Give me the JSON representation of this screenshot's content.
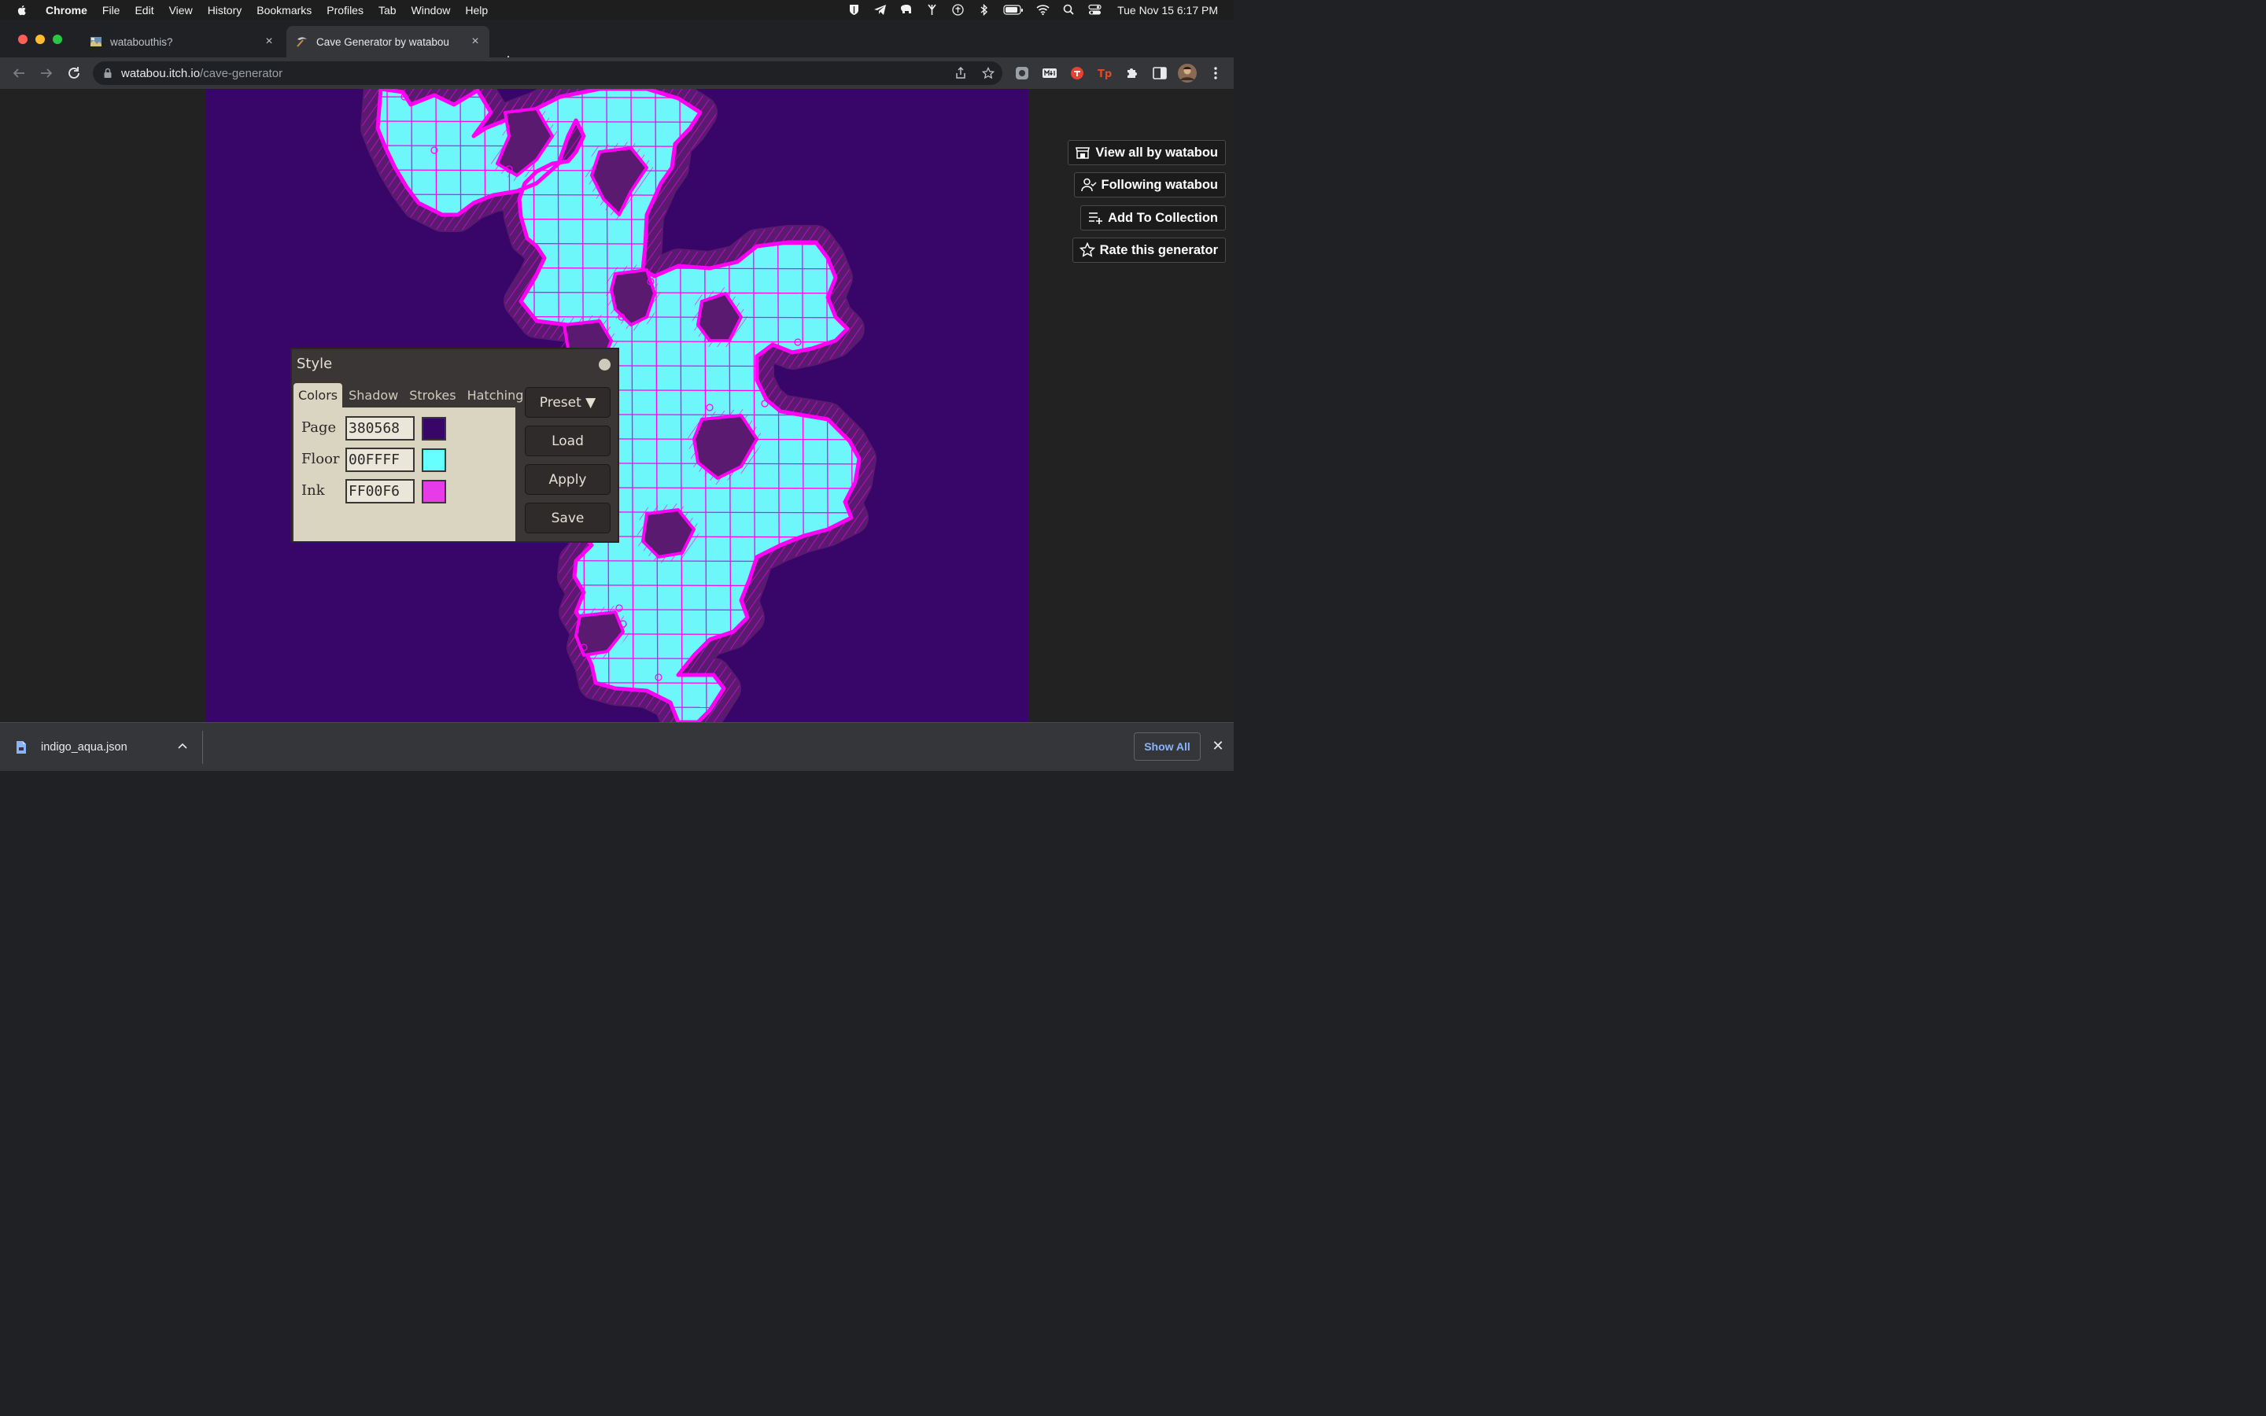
{
  "menubar": {
    "app": "Chrome",
    "menus": [
      "File",
      "Edit",
      "View",
      "History",
      "Bookmarks",
      "Profiles",
      "Tab",
      "Window",
      "Help"
    ],
    "clock": "Tue Nov 15  6:17 PM"
  },
  "tabs": [
    {
      "title": "watabouthis?",
      "active": false
    },
    {
      "title": "Cave Generator by watabou",
      "active": true
    }
  ],
  "address": {
    "host": "watabou.itch.io",
    "path": "/cave-generator"
  },
  "side_buttons": [
    {
      "label": "View all by watabou",
      "icon": "store-icon"
    },
    {
      "label": "Following watabou",
      "icon": "user-check-icon"
    },
    {
      "label": "Add To Collection",
      "icon": "playlist-add-icon"
    },
    {
      "label": "Rate this generator",
      "icon": "star-icon"
    }
  ],
  "style_dialog": {
    "title": "Style",
    "tabs": [
      "Colors",
      "Shadow",
      "Strokes",
      "Hatching"
    ],
    "active_tab": "Colors",
    "colors": [
      {
        "label": "Page",
        "value": "380568",
        "swatch": "#380568"
      },
      {
        "label": "Floor",
        "value": "00FFFF",
        "swatch": "#66ffff"
      },
      {
        "label": "Ink",
        "value": "FF00F6",
        "swatch": "#e73ae9"
      }
    ],
    "buttons": {
      "preset": "Preset ▼",
      "load": "Load",
      "apply": "Apply",
      "save": "Save"
    }
  },
  "download": {
    "filename": "indigo_aqua.json",
    "show_all": "Show All"
  },
  "colors": {
    "page": "#380568",
    "floor": "#6df7fb",
    "ink": "#ff00f6",
    "shadow": "#5a1a70"
  }
}
